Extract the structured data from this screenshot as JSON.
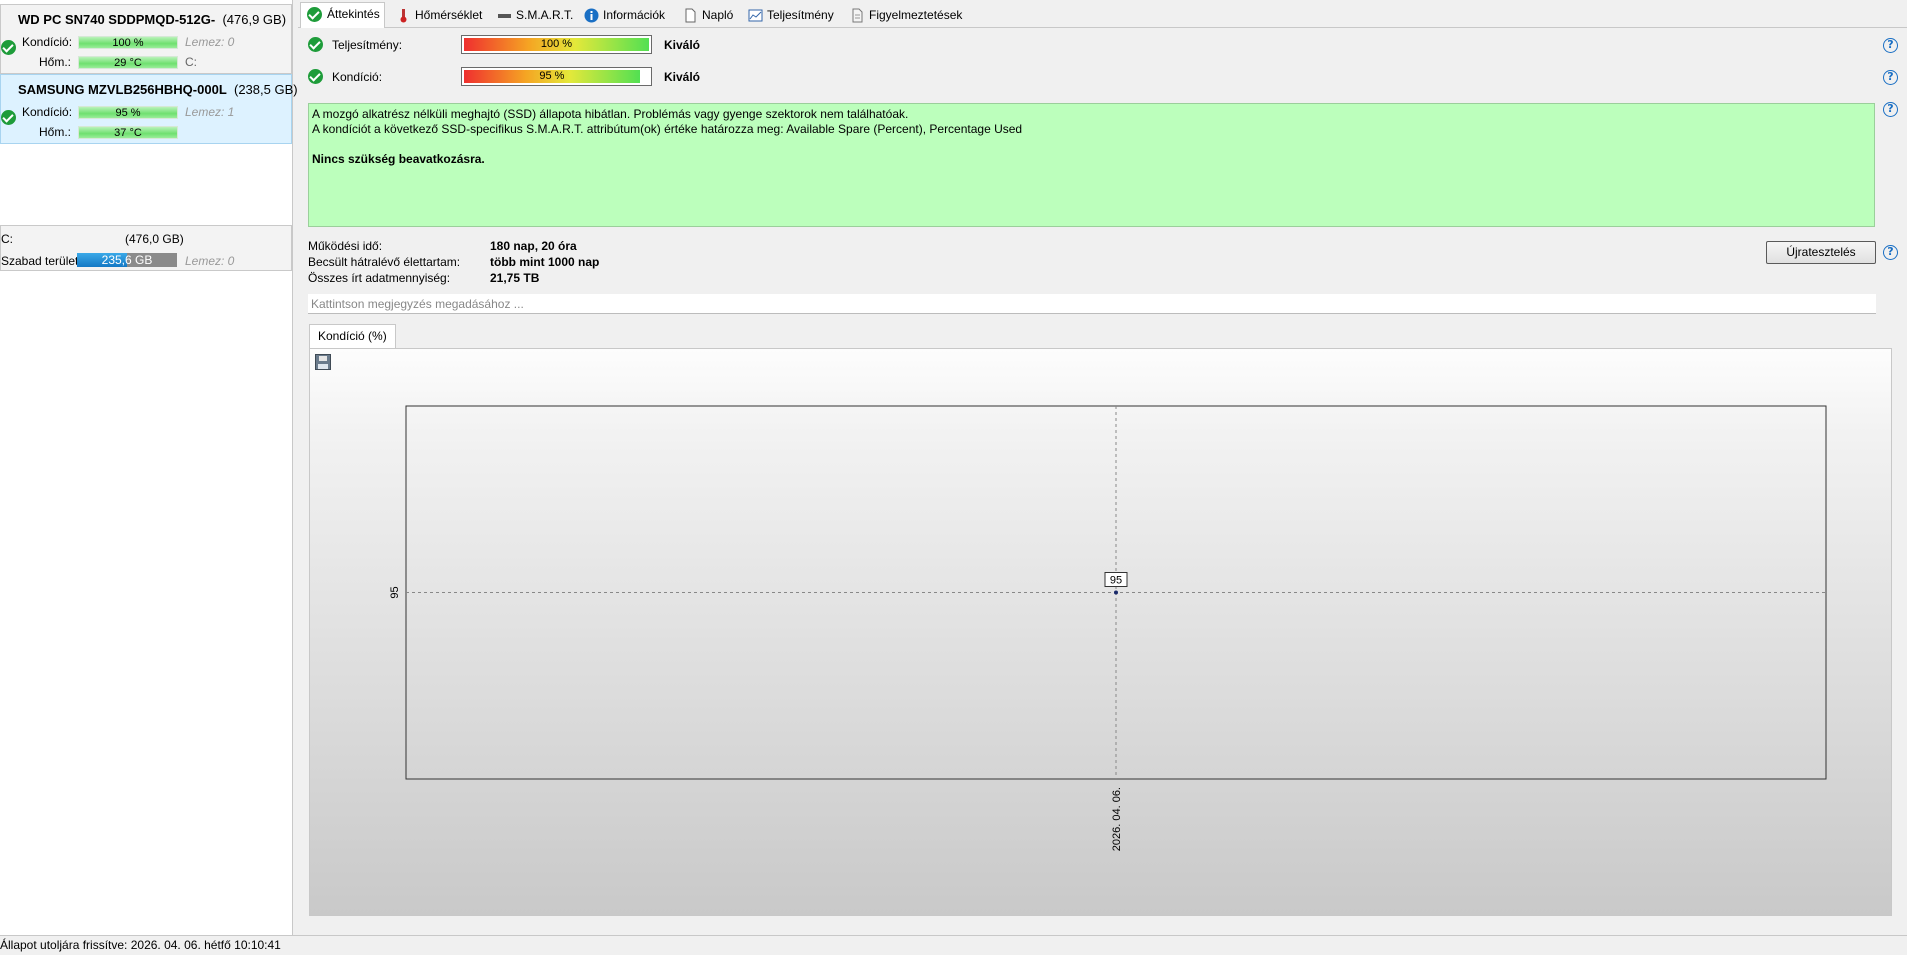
{
  "disks": [
    {
      "name": "WD PC SN740 SDDPMQD-512G-",
      "size": "(476,9 GB)",
      "condition_label": "Kondíció:",
      "condition_value": "100 %",
      "disk_index": "Lemez: 0",
      "temp_label": "Hőm.:",
      "temp_value": "29 °C",
      "drive_letter": "C:"
    },
    {
      "name": "SAMSUNG MZVLB256HBHQ-000L",
      "size": "(238,5 GB)",
      "condition_label": "Kondíció:",
      "condition_value": "95 %",
      "disk_index": "Lemez: 1",
      "temp_label": "Hőm.:",
      "temp_value": "37 °C"
    }
  ],
  "partition": {
    "letter": "C:",
    "size": "(476,0 GB)",
    "free_label": "Szabad terület",
    "free_value": "235,6 GB",
    "free_fraction": 0.495,
    "disk_index": "Lemez: 0"
  },
  "tabs": [
    {
      "label": "Áttekintés",
      "icon": "check-circle-icon",
      "active": true
    },
    {
      "label": "Hőmérséklet",
      "icon": "thermometer-icon"
    },
    {
      "label": "S.M.A.R.T.",
      "icon": "drive-icon"
    },
    {
      "label": "Információk",
      "icon": "info-icon"
    },
    {
      "label": "Napló",
      "icon": "document-icon"
    },
    {
      "label": "Teljesítmény",
      "icon": "performance-chart-icon"
    },
    {
      "label": "Figyelmeztetések",
      "icon": "alerts-icon"
    }
  ],
  "overview": {
    "performance": {
      "label": "Teljesítmény:",
      "value": "100 %",
      "fraction": 1.0,
      "rating": "Kiváló"
    },
    "condition": {
      "label": "Kondíció:",
      "value": "95 %",
      "fraction": 0.95,
      "rating": "Kiváló"
    },
    "message_lines": [
      "A mozgó alkatrész nélküli meghajtó (SSD) állapota hibátlan. Problémás vagy gyenge szektorok nem találhatóak.",
      "A kondíciót a következő SSD-specifikus S.M.A.R.T. attribútum(ok) értéke határozza meg:  Available Spare (Percent), Percentage Used"
    ],
    "message_bold": "Nincs szükség beavatkozásra.",
    "uptime_label": "Működési idő:",
    "uptime_value": "180 nap, 20 óra",
    "lifetime_label": "Becsült hátralévő élettartam:",
    "lifetime_value": "több mint 1000 nap",
    "written_label": "Összes írt adatmennyiség:",
    "written_value": "21,75 TB",
    "retest_label": "Újratesztelés",
    "note_placeholder": "Kattintson megjegyzés megadásához ...",
    "help_glyph": "?"
  },
  "chart_tab_label": "Kondíció  (%)",
  "chart_data": {
    "type": "line",
    "x": [
      "2026. 04. 06."
    ],
    "series": [
      {
        "values": [
          95
        ]
      }
    ],
    "y_tick_labels": [
      "95"
    ],
    "data_labels": [
      "95"
    ],
    "grid": true
  },
  "status_bar": "Állapot utoljára frissítve: 2026. 04. 06. hétfő 10:10:41",
  "colors": {
    "ok_green": "#1e9c3a",
    "message_bg": "#bcffbc",
    "free_space_blue": "#1478c4",
    "help_blue": "#1a6fc4"
  }
}
